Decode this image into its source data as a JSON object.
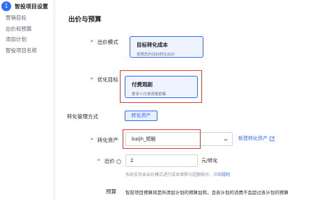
{
  "sidebar": {
    "step_number": "1",
    "step_title": "智投项目设置",
    "items": [
      {
        "label": "营销目标"
      },
      {
        "label": "出价和预算"
      },
      {
        "label": "添加计划"
      },
      {
        "label": "智投项目名称"
      }
    ]
  },
  "main": {
    "section_title": "出价与预算",
    "bid_mode": {
      "label": "出价模式",
      "option_title": "目标转化成本",
      "option_desc": "按照您的目标转化出价"
    },
    "opt_goal": {
      "label": "优化目标",
      "option_title": "付费观剧",
      "option_desc": "更多人付费观看剧集"
    },
    "conversion_mgmt": {
      "label": "转化管理方式",
      "button_label": "转化资产"
    },
    "conversion_asset": {
      "label": "转化资产",
      "selected_value": "baijh_短剧",
      "new_link": "新建转化资产"
    },
    "bid": {
      "label": "出价",
      "value": "2",
      "unit": "元/转化",
      "hint": "系统支持本出价模式进行成本保障与超额赔付，详细",
      "hint_link": "规则"
    },
    "budget": {
      "label": "预算",
      "text": "智投项目预算将是所添加计划的预算加和，且各计划的消费不会超过各计划的预算"
    }
  },
  "colors": {
    "accent": "#2f6bff",
    "required": "#e6392e",
    "highlight_box": "#e6392e"
  },
  "icons": {
    "chevron": "chevron-down-icon",
    "external_link": "external-link-icon",
    "help": "help-circle-icon"
  }
}
